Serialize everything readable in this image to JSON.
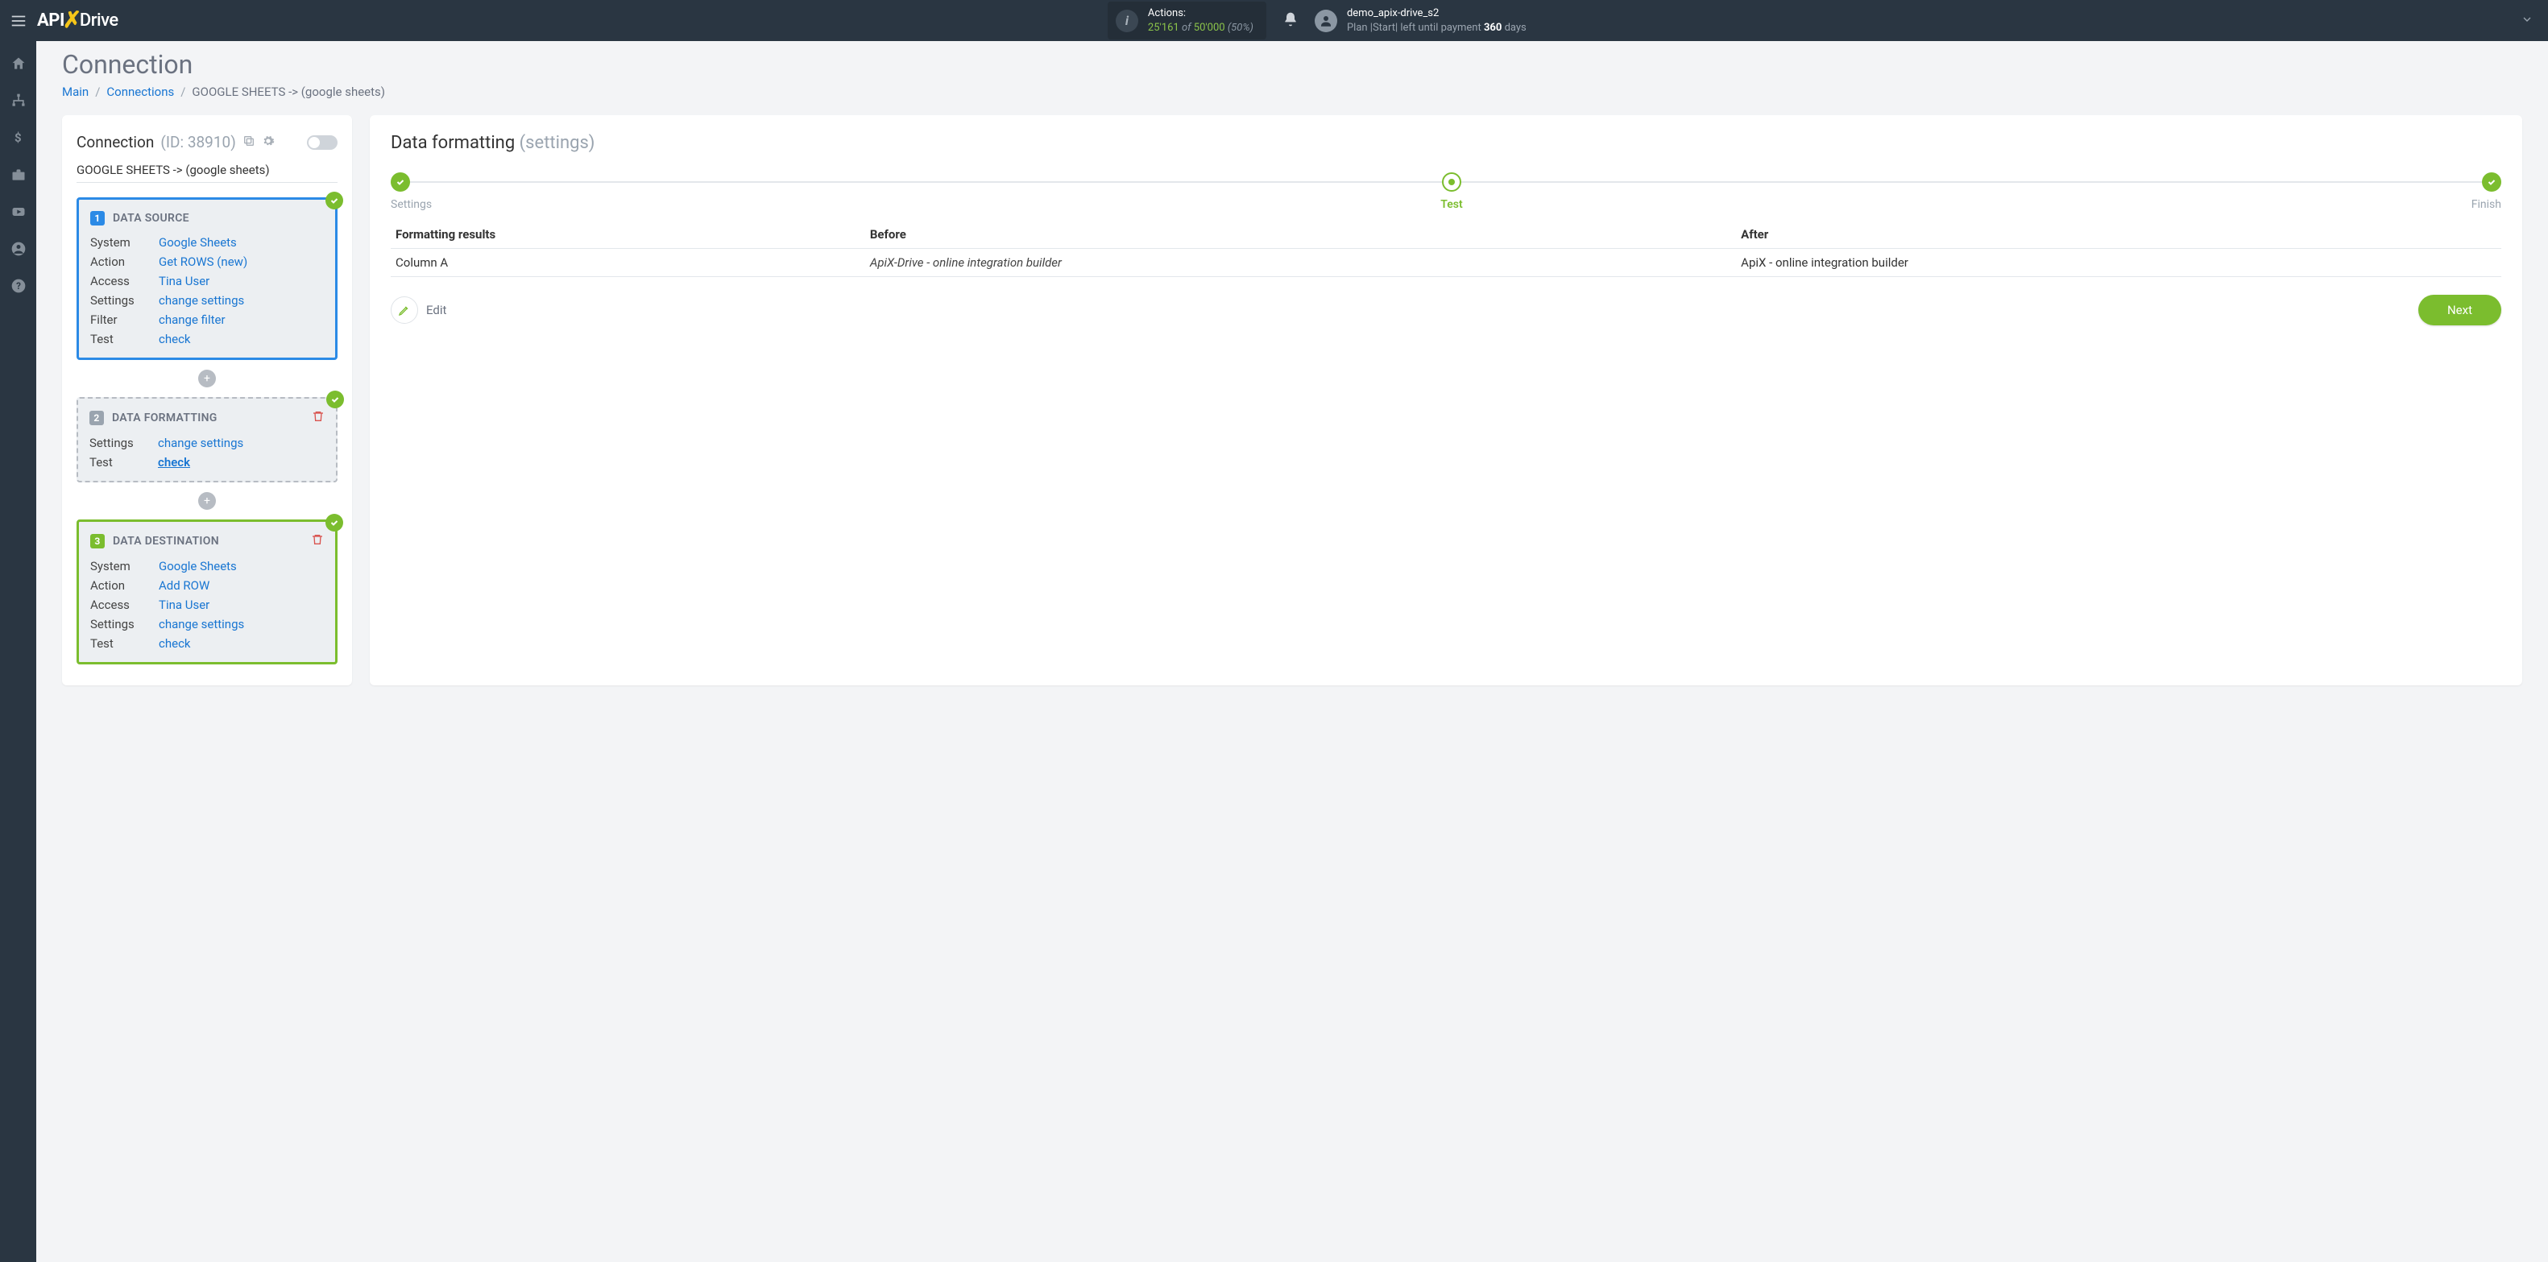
{
  "topbar": {
    "actions_label": "Actions:",
    "actions_current": "25'161",
    "actions_of": "of",
    "actions_total": "50'000",
    "actions_pct": "(50%)",
    "user_name": "demo_apix-drive_s2",
    "plan_prefix": "Plan |Start| left until payment",
    "days_count": "360",
    "days_label": "days"
  },
  "page": {
    "title": "Connection",
    "breadcrumb_main": "Main",
    "breadcrumb_connections": "Connections",
    "breadcrumb_current": "GOOGLE SHEETS -> (google sheets)"
  },
  "pipe": {
    "title": "Connection",
    "id_label": "(ID: 38910)",
    "subtitle": "GOOGLE SHEETS -> (google sheets)",
    "source": {
      "num": "1",
      "head": "DATA SOURCE",
      "rows": [
        {
          "k": "System",
          "v": "Google Sheets"
        },
        {
          "k": "Action",
          "v": "Get ROWS (new)"
        },
        {
          "k": "Access",
          "v": "Tina User"
        },
        {
          "k": "Settings",
          "v": "change settings"
        },
        {
          "k": "Filter",
          "v": "change filter"
        },
        {
          "k": "Test",
          "v": "check"
        }
      ]
    },
    "format": {
      "num": "2",
      "head": "DATA FORMATTING",
      "rows": [
        {
          "k": "Settings",
          "v": "change settings"
        },
        {
          "k": "Test",
          "v": "check",
          "underline": true
        }
      ]
    },
    "dest": {
      "num": "3",
      "head": "DATA DESTINATION",
      "rows": [
        {
          "k": "System",
          "v": "Google Sheets"
        },
        {
          "k": "Action",
          "v": "Add ROW"
        },
        {
          "k": "Access",
          "v": "Tina User"
        },
        {
          "k": "Settings",
          "v": "change settings"
        },
        {
          "k": "Test",
          "v": "check"
        }
      ]
    }
  },
  "right": {
    "title": "Data formatting",
    "subtitle": "(settings)",
    "steps": {
      "settings": "Settings",
      "test": "Test",
      "finish": "Finish"
    },
    "table": {
      "h1": "Formatting results",
      "h2": "Before",
      "h3": "After",
      "rows": [
        {
          "c1": "Column A",
          "c2": "ApiX-Drive - online integration builder",
          "c3": "ApiX - online integration builder"
        }
      ]
    },
    "edit_label": "Edit",
    "next_label": "Next"
  }
}
